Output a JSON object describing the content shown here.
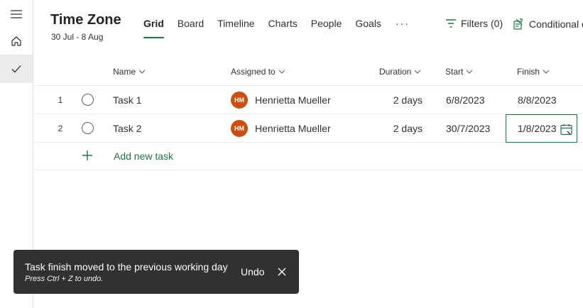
{
  "rail": {
    "items": [
      {
        "icon": "hamburger-menu-icon"
      },
      {
        "icon": "home-icon"
      },
      {
        "icon": "checkmark-icon",
        "active": true
      }
    ]
  },
  "header": {
    "title": "Time Zone",
    "subtitle": "30 Jul - 8 Aug"
  },
  "tabs": [
    {
      "label": "Grid",
      "active": true
    },
    {
      "label": "Board"
    },
    {
      "label": "Timeline"
    },
    {
      "label": "Charts"
    },
    {
      "label": "People"
    },
    {
      "label": "Goals"
    },
    {
      "label": "···"
    }
  ],
  "toolbar": {
    "filters_label": "Filters (0)",
    "conditional_label": "Conditional c"
  },
  "columns": {
    "name": "Name",
    "assigned": "Assigned to",
    "duration": "Duration",
    "start": "Start",
    "finish": "Finish"
  },
  "rows": [
    {
      "num": "1",
      "name": "Task 1",
      "initials": "HM",
      "assignee": "Henrietta Mueller",
      "duration": "2 days",
      "start": "6/8/2023",
      "finish": "8/8/2023"
    },
    {
      "num": "2",
      "name": "Task 2",
      "initials": "HM",
      "assignee": "Henrietta Mueller",
      "duration": "2 days",
      "start": "30/7/2023",
      "finish": "1/8/2023",
      "editing": true
    }
  ],
  "add_task_label": "Add new task",
  "toast": {
    "message": "Task finish moved to the previous working day",
    "hint": "Press Ctrl + Z to undo.",
    "undo_label": "Undo"
  },
  "colors": {
    "accent": "#217346",
    "avatar": "#ca5010",
    "toast_bg": "#323130"
  }
}
